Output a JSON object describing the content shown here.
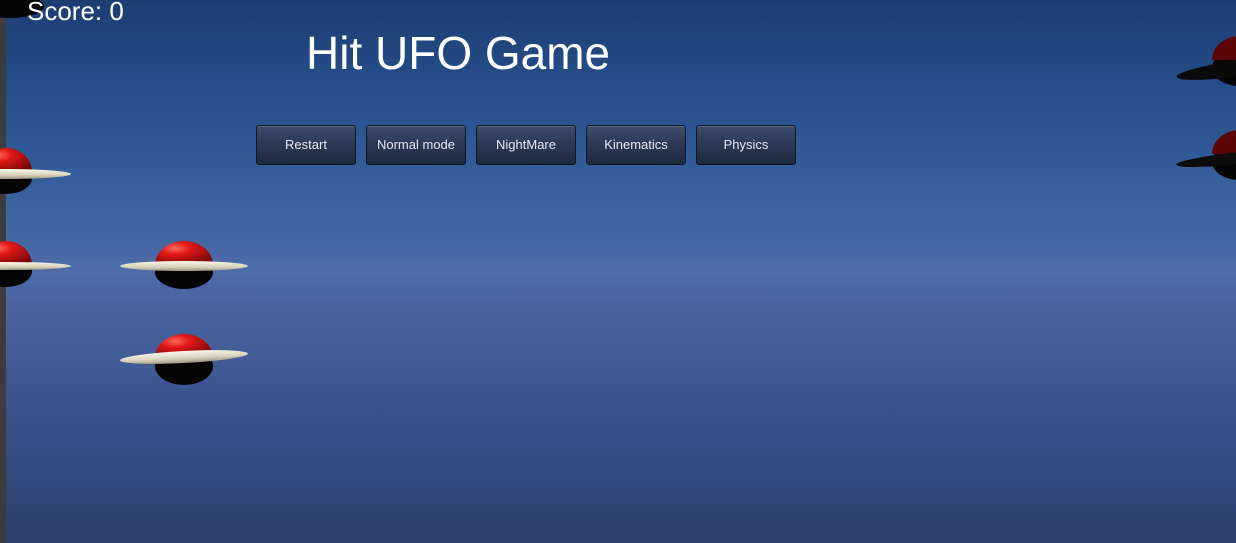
{
  "hud": {
    "score_label": "Score: 0",
    "title": "Hit UFO Game"
  },
  "buttons": [
    {
      "id": "restart",
      "label": "Restart"
    },
    {
      "id": "normal-mode",
      "label": "Normal mode"
    },
    {
      "id": "nightmare",
      "label": "NightMare"
    },
    {
      "id": "kinematics",
      "label": "Kinematics"
    },
    {
      "id": "physics",
      "label": "Physics"
    }
  ],
  "scene": {
    "ufo_count_visible": 8,
    "colors": {
      "sky_top": "#1d3d72",
      "sky_mid": "#4e6ca8",
      "sky_bottom": "#2e406c",
      "ufo_dome": "#d41414",
      "ufo_disc": "#e8e4d4",
      "ufo_shadow": "#050505"
    }
  }
}
